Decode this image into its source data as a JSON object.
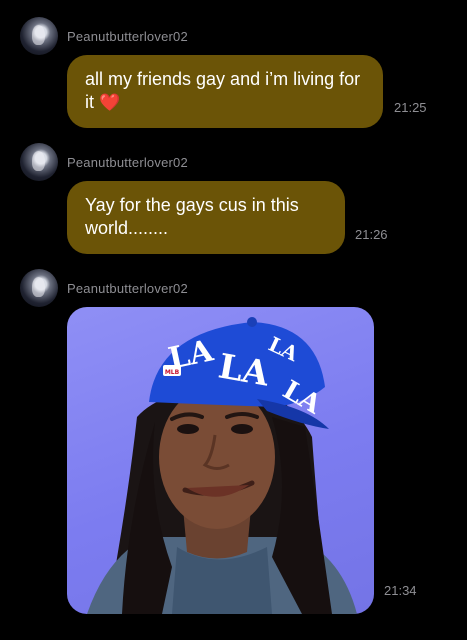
{
  "messages": [
    {
      "sender": "Peanutbutterlover02",
      "text": "all my friends gay and i’m living for it",
      "emoji": "❤️",
      "time": "21:25"
    },
    {
      "sender": "Peanutbutterlover02",
      "text": "Yay for the gays cus in this world........",
      "time": "21:26"
    },
    {
      "sender": "Peanutbutterlover02",
      "image": {
        "cap_text": "LA",
        "badge": "MLB"
      },
      "time": "21:34"
    }
  ],
  "colors": {
    "background": "#000000",
    "bubble": "#6b5407",
    "meta_text": "#8e8e93",
    "image_backdrop": "#7c7cf0",
    "cap": "#1e4bd6"
  },
  "icons": [
    "avatar"
  ]
}
